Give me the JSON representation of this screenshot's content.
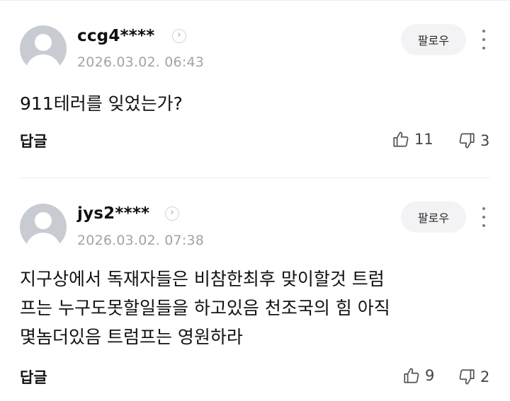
{
  "comments": [
    {
      "username": "ccg4****",
      "timestamp": "2026.03.02. 06:43",
      "follow_label": "팔로우",
      "content_lines": [
        "911테러를 잊었는가?"
      ],
      "reply_label": "답글",
      "likes": "11",
      "dislikes": "3"
    },
    {
      "username": "jys2****",
      "timestamp": "2026.03.02. 07:38",
      "follow_label": "팔로우",
      "content_lines": [
        "지구상에서 독재자들은 비참한최후 맞이할것 트럼",
        "프는 누구도못할일들을 하고있음 천조국의 힘 아직",
        "몇놈더있음 트럼프는 영원하라"
      ],
      "reply_label": "답글",
      "likes": "9",
      "dislikes": "2"
    }
  ]
}
